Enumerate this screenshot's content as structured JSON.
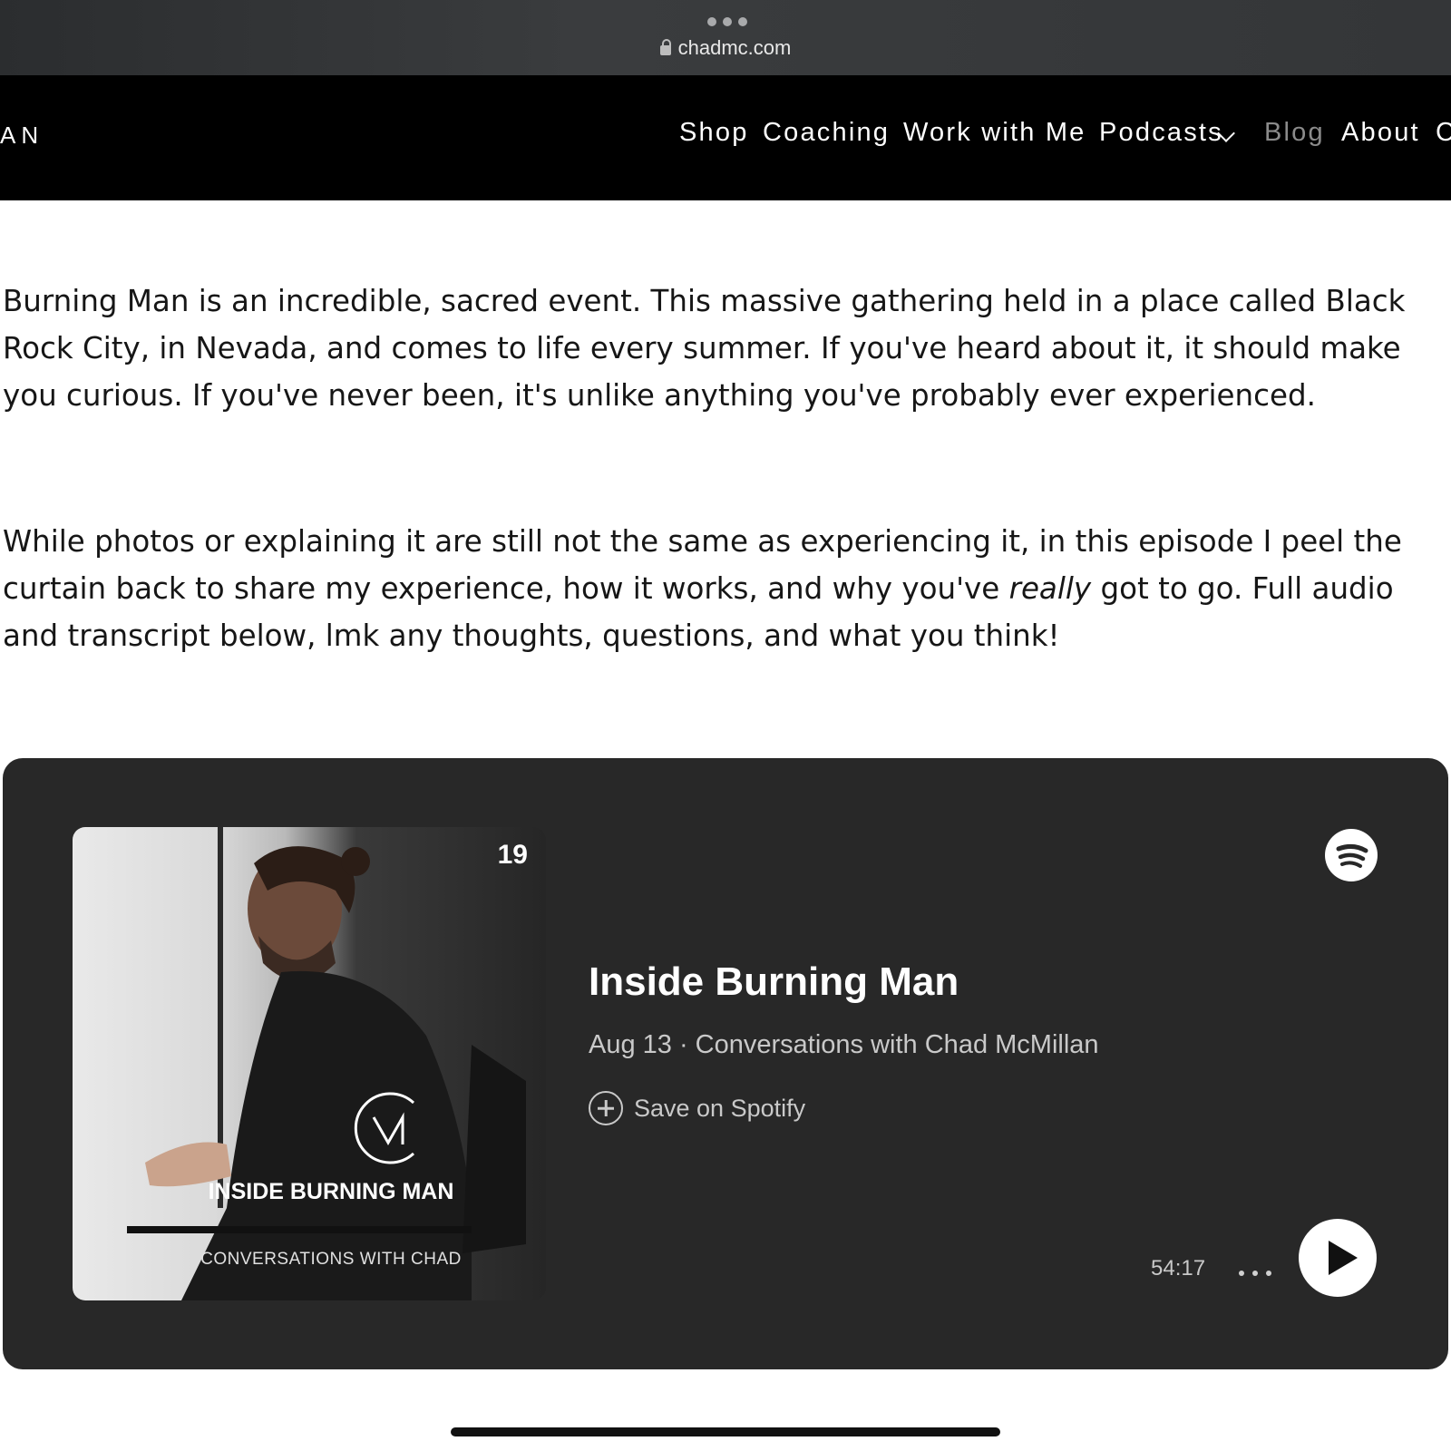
{
  "browser": {
    "url": "chadmc.com"
  },
  "nav": {
    "logo": "AN",
    "items": [
      "Shop",
      "Coaching",
      "Work with Me",
      "Podcasts",
      "Blog",
      "About",
      "C"
    ]
  },
  "article": {
    "para1": "Burning Man is an incredible, sacred event. This massive gathering held in a place called Black Rock City, in Nevada, and comes to life every summer. If you've heard about it, it should make you curious. If you've never been, it's unlike anything you've probably ever experienced.",
    "para2_before": "While photos or explaining it are still not the same as experiencing it, in this episode I peel the curtain back to share my experience, how it works, and why you've ",
    "para2_emphasis": "really",
    "para2_after": " got to go. Full audio and transcript below, lmk any thoughts, questions, and what you think!"
  },
  "player": {
    "cover_number": "19",
    "cover_title": "INSIDE BURNING MAN",
    "cover_subtitle": "CONVERSATIONS WITH CHAD",
    "episode_title": "Inside Burning Man",
    "meta": "Aug 13 · Conversations with Chad McMillan",
    "save_label": "Save on Spotify",
    "duration": "54:17"
  }
}
